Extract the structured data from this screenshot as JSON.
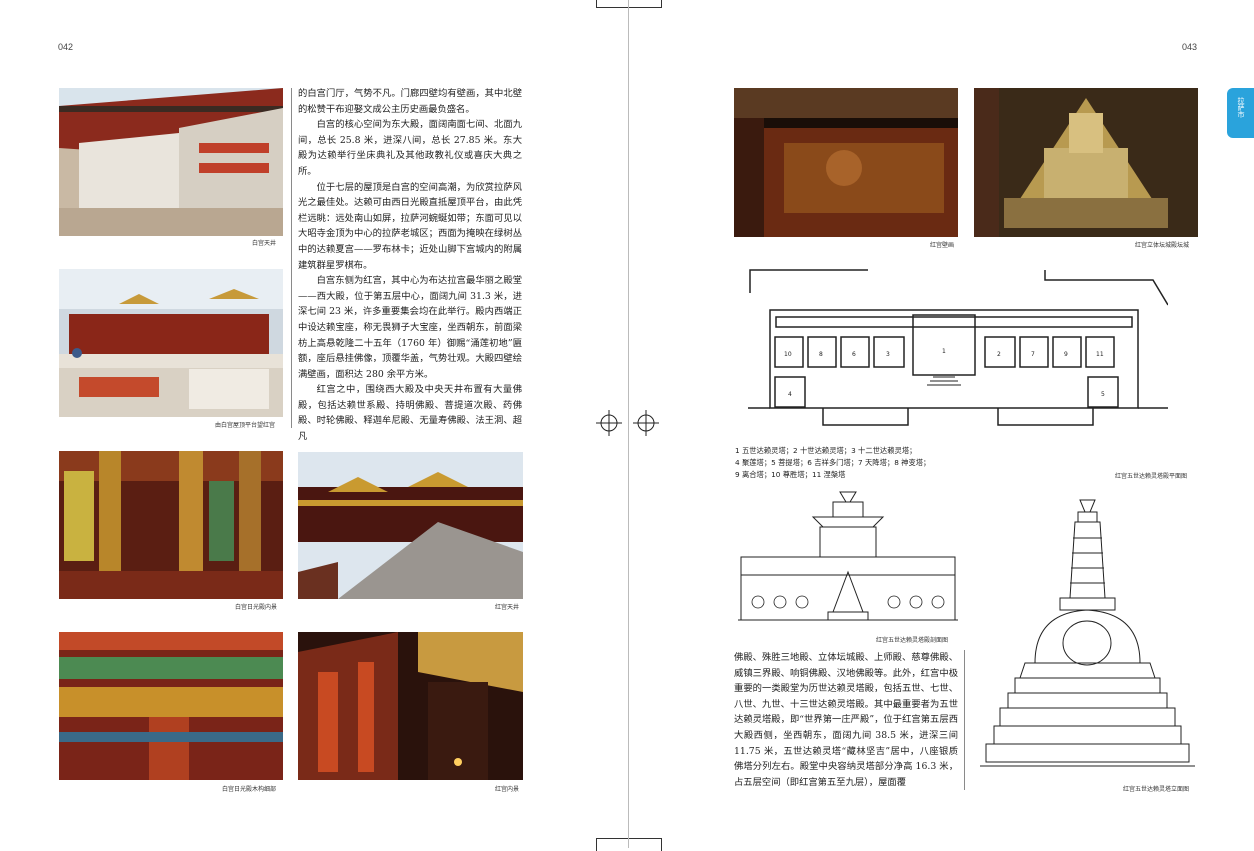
{
  "left_page": {
    "page_number": "042",
    "photos": [
      {
        "caption": "白宫天井"
      },
      {
        "caption": "由白宫屋顶平台望红宫"
      },
      {
        "caption": "白宫日光殿内景"
      },
      {
        "caption": "红宫天井"
      },
      {
        "caption": "白宫日光殿木构细部"
      },
      {
        "caption": "红宫内景"
      }
    ],
    "paragraphs": [
      "的白宫门厅，气势不凡。门廊四壁均有壁画，其中北壁的松赞干布迎娶文成公主历史画最负盛名。",
      "白宫的核心空间为东大殿，面阔南面七间、北面九间，总长 25.8 米，进深八间，总长 27.85 米。东大殿为达赖举行坐床典礼及其他政教礼仪或喜庆大典之所。",
      "位于七层的屋顶是白宫的空间高潮，为欣赏拉萨风光之最佳处。达赖可由西日光殿直抵屋顶平台，由此凭栏远眺：远处南山如屏，拉萨河蜿蜒如带；东面可见以大昭寺金顶为中心的拉萨老城区；西面为掩映在绿树丛中的达赖夏宫——罗布林卡；近处山脚下宫城内的附属建筑群星罗棋布。",
      "白宫东侧为红宫，其中心为布达拉宫最华丽之殿堂——西大殿，位于第五层中心，面阔九间 31.3 米，进深七间 23 米，许多重要集会均在此举行。殿内西端正中设达赖宝座，称无畏狮子大宝座，坐西朝东，前面梁枋上高悬乾隆二十五年（1760 年）御赐“涌莲初地”匾额，座后悬挂佛像，顶覆华盖，气势壮观。大殿四壁绘满壁画，面积达 280 余平方米。",
      "红宫之中，围绕西大殿及中央天井布置有大量佛殿，包括达赖世系殿、持明佛殿、菩提道次殿、药佛殿、时轮佛殿、释迦牟尼殿、无量寿佛殿、法王洞、超凡"
    ]
  },
  "right_page": {
    "page_number": "043",
    "side_tab": "拉萨市",
    "photos": [
      {
        "caption": "红宫壁画"
      },
      {
        "caption": "红宫立体坛城殿坛城"
      }
    ],
    "plan": {
      "room_numbers": [
        "10",
        "8",
        "6",
        "3",
        "1",
        "2",
        "7",
        "9",
        "11",
        "4",
        "5"
      ],
      "legend": [
        "1 五世达赖灵塔；2 十世达赖灵塔；3 十二世达赖灵塔；",
        "4 聚莲塔；5 菩提塔；6 吉祥多门塔；7 天降塔；8 神变塔；",
        "9 离合塔；10 尊胜塔；11 涅槃塔"
      ],
      "caption": "红宫五世达赖灵塔殿平面图"
    },
    "section_caption": "红宫五世达赖灵塔殿剖面图",
    "elevation_caption": "红宫五世达赖灵塔立面图",
    "text": "佛殿、殊胜三地殿、立体坛城殿、上师殿、慈尊佛殿、威镇三界殿、响铜佛殿、汉地佛殿等。此外，红宫中极重要的一类殿堂为历世达赖灵塔殿，包括五世、七世、八世、九世、十三世达赖灵塔殿。其中最重要者为五世达赖灵塔殿，即“世界第一庄严殿”，位于红宫第五层西大殿西侧，坐西朝东，面阔九间 38.5 米，进深三间 11.75 米，五世达赖灵塔“藏林坚吉”居中，八座银质佛塔分列左右。殿堂中央容纳灵塔部分净高 16.3 米，占五层空间（即红宫第五至九层），屋面覆"
  }
}
